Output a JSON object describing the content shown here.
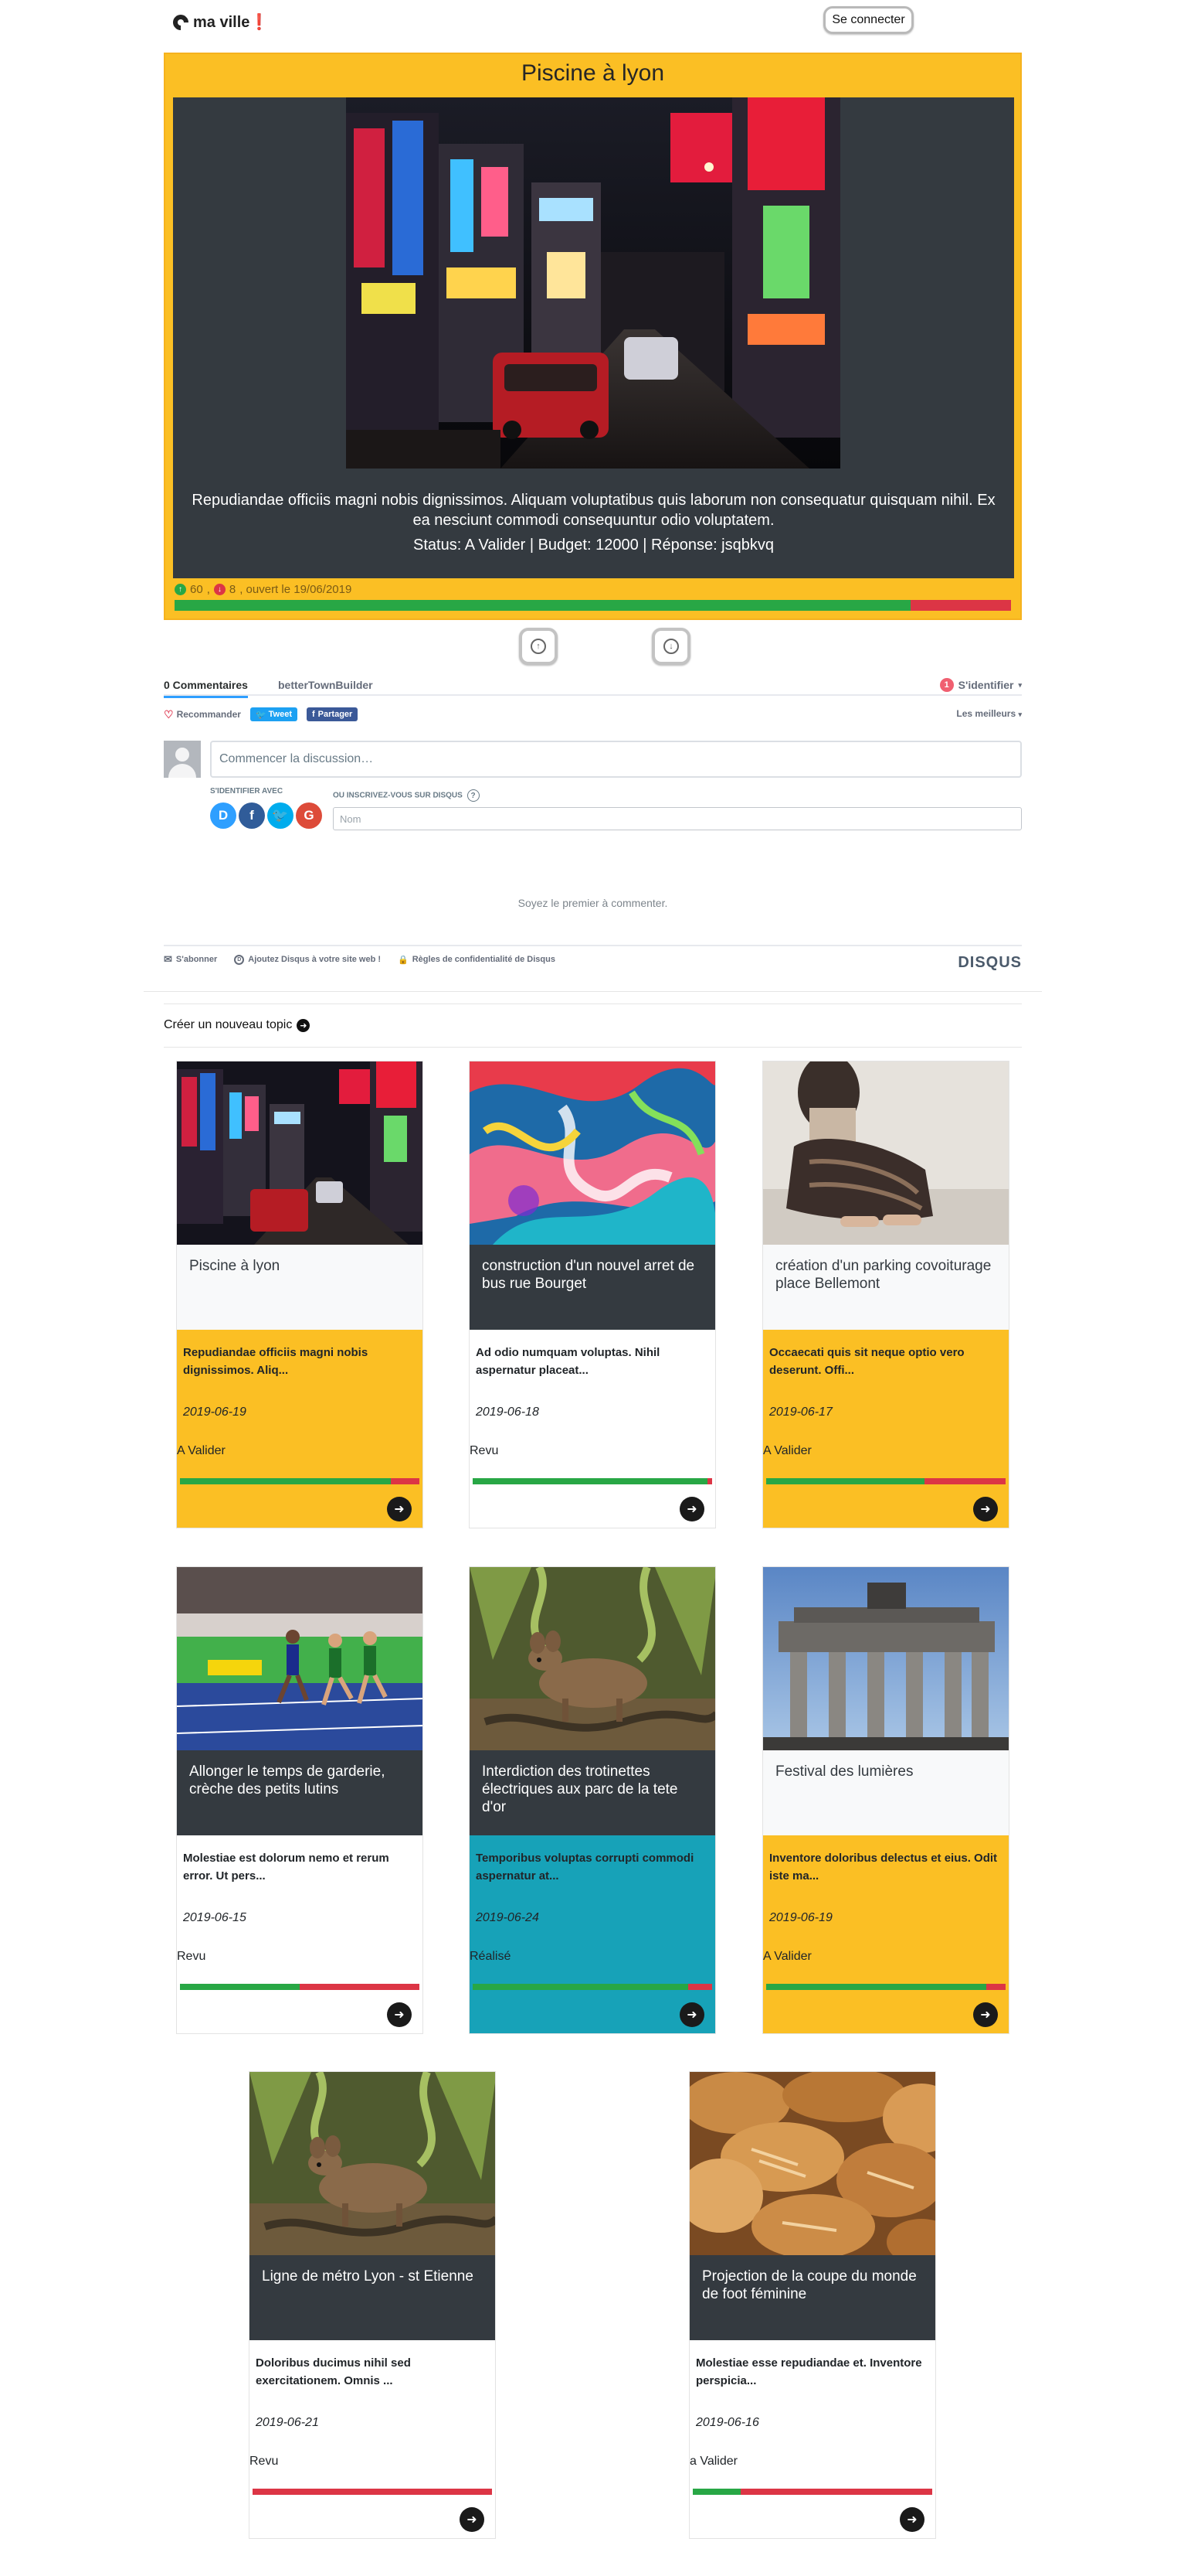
{
  "header": {
    "brand": "ma ville❗",
    "login_label": "Se connecter"
  },
  "featured": {
    "title": "Piscine à lyon",
    "description": "Repudiandae officiis magni nobis dignissimos. Aliquam voluptatibus quis laborum non consequatur quisquam nihil. Ex ea nesciunt commodi consequuntur odio voluptatem.",
    "status_line": "Status: A Valider | Budget: 12000 | Réponse: jsqbkvq",
    "upvotes": "60",
    "downvotes": "8",
    "opened": ", ouvert le 19/06/2019",
    "approval_fraction": 0.88,
    "colors": {
      "card": "#fbbf24",
      "panel": "#343a40",
      "up": "#28a745",
      "down": "#dc3545"
    }
  },
  "vote_buttons": {
    "up_icon": "arrow-up-circle-icon",
    "down_icon": "arrow-down-circle-icon"
  },
  "disqus": {
    "tab_comments": "0 Commentaires",
    "tab_site": "betterTownBuilder",
    "login": "S'identifier",
    "notif_count": "1",
    "recommend": "Recommander",
    "tweet": "Tweet",
    "share": "Partager",
    "sort": "Les meilleurs",
    "placeholder": "Commencer la discussion…",
    "login_with": "S'IDENTIFIER AVEC",
    "signup": "OU INSCRIVEZ-VOUS SUR DISQUS",
    "name_placeholder": "Nom",
    "empty": "Soyez le premier à commenter.",
    "subscribe": "S'abonner",
    "add_disqus": "Ajoutez Disqus à votre site web !",
    "privacy": "Règles de confidentialité de Disqus",
    "logo": "DISQUS"
  },
  "new_topic_label": "Créer un nouveau topic",
  "cards": [
    {
      "title": "Piscine à lyon",
      "summary": "Repudiandae officiis magni nobis dignissimos. Aliq...",
      "date": "2019-06-19",
      "status": "A Valider",
      "approval_fraction": 0.88,
      "head": "light",
      "body": "yellow",
      "image": "city-night"
    },
    {
      "title": "construction d'un nouvel arret de bus rue Bourget",
      "summary": "Ad odio numquam voluptas. Nihil aspernatur placeat...",
      "date": "2019-06-18",
      "status": "Revu",
      "approval_fraction": 0.98,
      "head": "dark",
      "body": "white",
      "image": "abstract-paint"
    },
    {
      "title": "création d'un parking covoiturage place Bellemont",
      "summary": "Occaecati quis sit neque optio vero deserunt. Offi...",
      "date": "2019-06-17",
      "status": "A Valider",
      "approval_fraction": 0.66,
      "head": "light",
      "body": "yellow",
      "image": "seated-woman"
    },
    {
      "title": "Allonger le temps de garderie, crèche des petits lutins",
      "summary": "Molestiae est dolorum nemo et rerum error. Ut pers...",
      "date": "2019-06-15",
      "status": "Revu",
      "approval_fraction": 0.5,
      "head": "dark",
      "body": "white",
      "image": "runners"
    },
    {
      "title": "Interdiction des trotinettes électriques aux parc de la tete d'or",
      "summary": "Temporibus voluptas corrupti commodi aspernatur at...",
      "date": "2019-06-24",
      "status": "Réalisé",
      "approval_fraction": 0.9,
      "head": "dark",
      "body": "teal",
      "image": "deer"
    },
    {
      "title": "Festival des lumières",
      "summary": "Inventore doloribus delectus et eius. Odit iste ma...",
      "date": "2019-06-19",
      "status": "A Valider",
      "approval_fraction": 0.92,
      "head": "light",
      "body": "yellow",
      "image": "gate"
    },
    {
      "title": "Ligne de métro Lyon - st Etienne",
      "summary": "Doloribus ducimus nihil sed exercitationem. Omnis ...",
      "date": "2019-06-21",
      "status": "Revu",
      "approval_fraction": 0.0,
      "head": "dark",
      "body": "white",
      "image": "deer"
    },
    {
      "title": "Projection de la coupe du monde de foot féminine",
      "summary": "Molestiae esse repudiandae et. Inventore perspicia...",
      "date": "2019-06-16",
      "status": "a Valider",
      "approval_fraction": 0.2,
      "head": "dark",
      "body": "white",
      "image": "bread"
    }
  ]
}
